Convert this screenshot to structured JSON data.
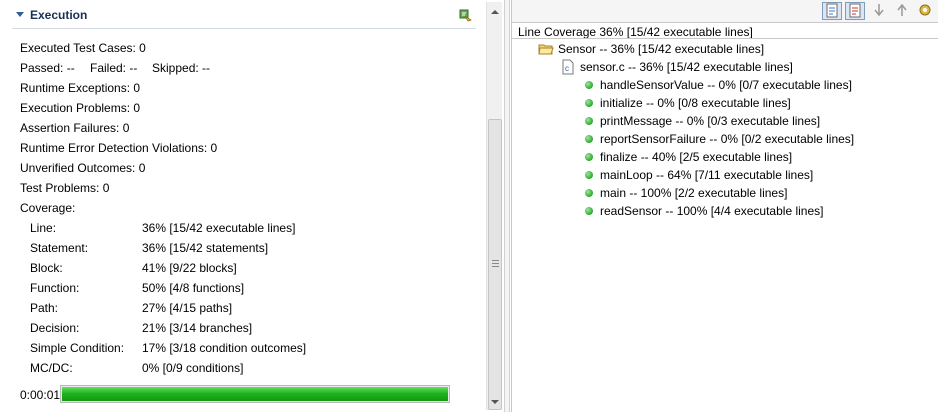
{
  "execution": {
    "title": "Execution",
    "stats": {
      "executed": "Executed Test Cases: 0",
      "passed": "Passed:  --",
      "failed": "Failed: --",
      "skipped": "Skipped: --",
      "runtime_exceptions": "Runtime Exceptions: 0",
      "execution_problems": "Execution Problems: 0",
      "assertion_failures": "Assertion Failures: 0",
      "runtime_error_detection": "Runtime Error Detection Violations: 0",
      "unverified_outcomes": "Unverified Outcomes: 0",
      "test_problems": "Test Problems: 0",
      "coverage_heading": "Coverage:"
    },
    "coverage": [
      {
        "label": "Line:",
        "value": "36% [15/42 executable lines]"
      },
      {
        "label": "Statement:",
        "value": "36% [15/42 statements]"
      },
      {
        "label": "Block:",
        "value": "41% [9/22 blocks]"
      },
      {
        "label": "Function:",
        "value": "50% [4/8 functions]"
      },
      {
        "label": "Path:",
        "value": "27% [4/15 paths]"
      },
      {
        "label": "Decision:",
        "value": "21% [3/14 branches]"
      },
      {
        "label": "Simple Condition:",
        "value": "17% [3/18 condition outcomes]"
      },
      {
        "label": "MC/DC:",
        "value": "0% [0/9 conditions]"
      }
    ],
    "elapsed": "0:00:01",
    "progress_percent": 100,
    "progress_color": "#21b321"
  },
  "coverage_view": {
    "title": "Line Coverage 36% [15/42 executable lines]",
    "project": "Sensor -- 36% [15/42 executable lines]",
    "file": "sensor.c -- 36% [15/42 executable lines]",
    "functions": [
      "handleSensorValue -- 0% [0/7 executable lines]",
      "initialize -- 0% [0/8 executable lines]",
      "printMessage -- 0% [0/3 executable lines]",
      "reportSensorFailure -- 0% [0/2 executable lines]",
      "finalize -- 40% [2/5 executable lines]",
      "mainLoop -- 64% [7/11 executable lines]",
      "main -- 100% [2/2 executable lines]",
      "readSensor -- 100% [4/4 executable lines]"
    ],
    "toolbar_icons": [
      "line-coverage-view-icon",
      "statement-view-icon",
      "move-down-icon",
      "move-up-icon",
      "settings-icon"
    ]
  }
}
